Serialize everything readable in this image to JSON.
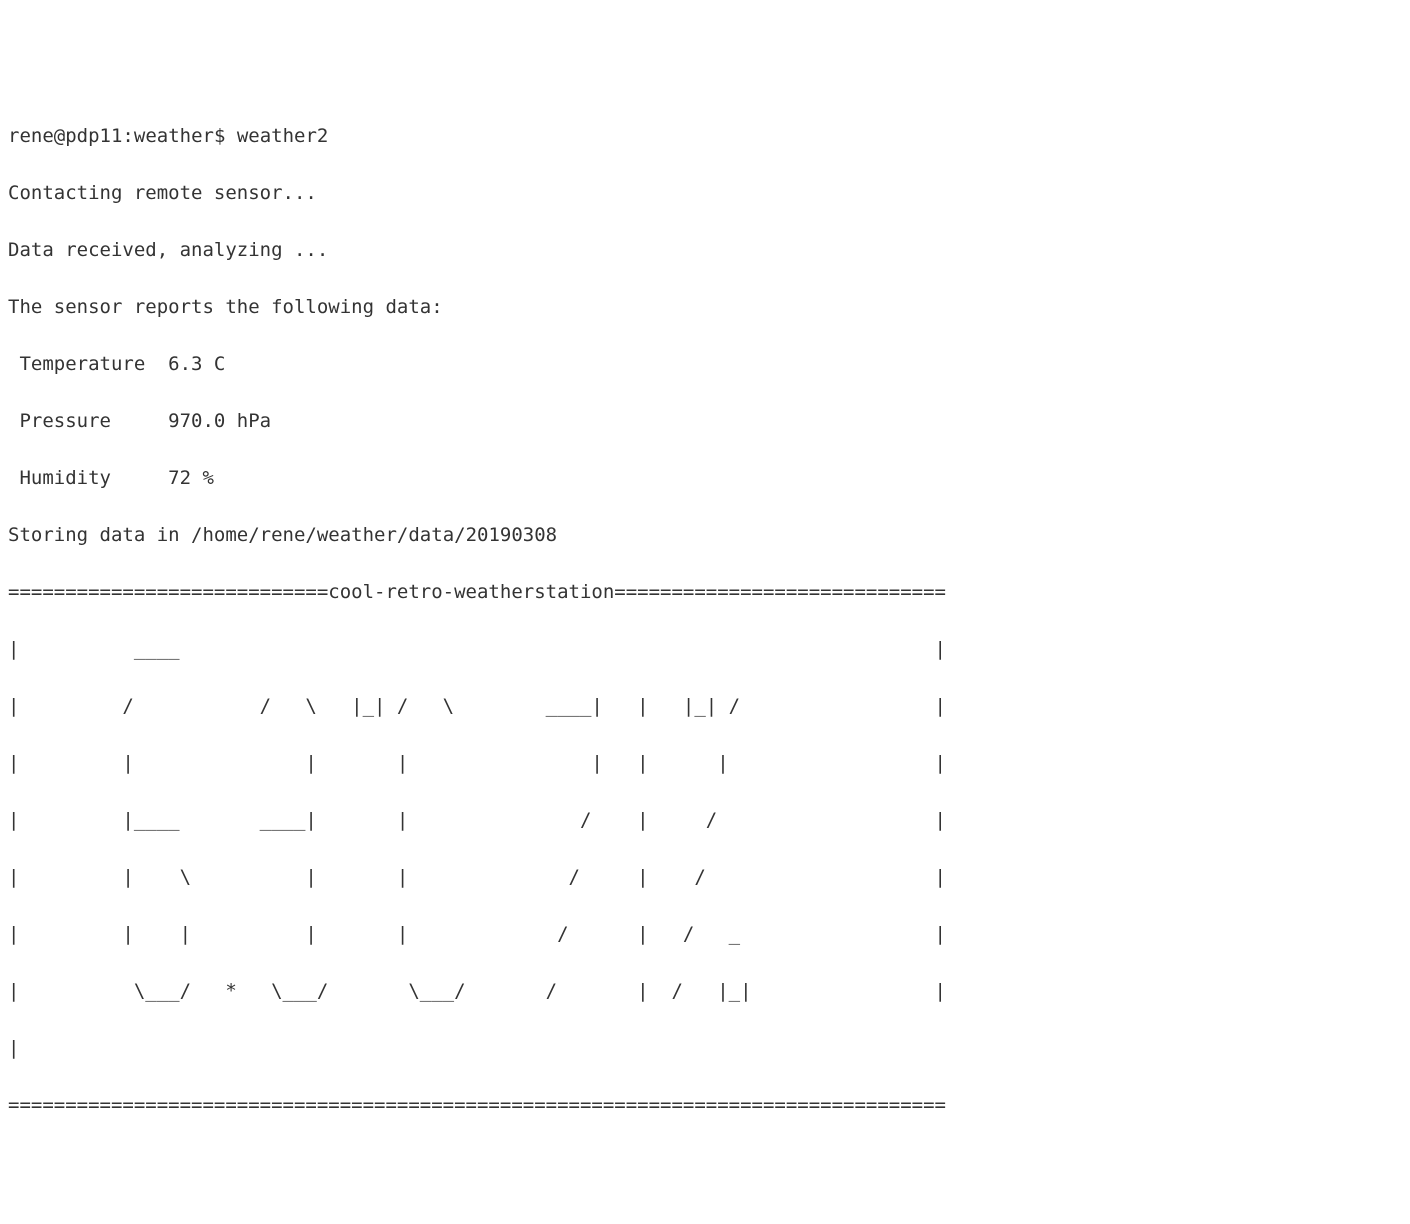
{
  "prompt": {
    "user": "rene",
    "host": "pdp11",
    "cwd": "weather",
    "command": "weather2"
  },
  "status": {
    "contacting": "Contacting remote sensor...",
    "received": "Data received, analyzing ...",
    "reports": "The sensor reports the following data:"
  },
  "readings": {
    "temp_label": " Temperature",
    "temp_value": "6.3 C",
    "press_label": " Pressure",
    "press_value": "970.0 hPa",
    "humid_label": " Humidity",
    "humid_value": "72 %"
  },
  "storing": {
    "prefix": "Storing data in ",
    "path": "/home/rene/weather/data/20190308"
  },
  "banner_title": "cool-retro-weatherstation",
  "ascii": {
    "l0": "============================cool-retro-weatherstation=============================",
    "l1": "|          ____                                                                  |",
    "l2": "|         /           /   \\   |_| /   \\        ____|   |   |_| /                 |",
    "l3": "|         |               |       |                |   |      |                  |",
    "l4": "|         |____       ____|       |               /    |     /                   |",
    "l5": "|         |    \\          |       |              /     |    /                    |",
    "l6": "|         |    |          |       |             /      |   /   _                 |",
    "l7": "|          \\___/   *   \\___/       \\___/       /       |  /   |_|                |",
    "l8": "|                                                                                 ",
    "l9": "=================================================================================="
  }
}
